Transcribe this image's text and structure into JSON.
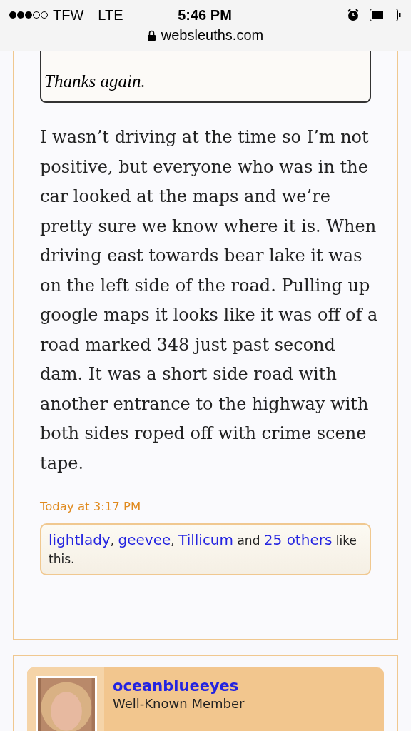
{
  "status_bar": {
    "carrier": "TFW",
    "network": "LTE",
    "time": "5:46 PM"
  },
  "address_bar": {
    "url": "websleuths.com"
  },
  "quote": {
    "text": "Thanks again."
  },
  "post": {
    "body": "I wasn’t driving at the time so I’m not positive, but everyone who was in the car looked at the maps and we’re pretty sure we know where it is. When driving east towards bear lake it was on the left side of the road. Pulling up google maps it looks like it was off of a road marked 348 just past second dam. It was a short side road with another entrance to the highway with both sides roped off with crime scene tape.",
    "date": "Today at 3:17 PM",
    "likes": [
      {
        "kind": "link",
        "text": "lightlady"
      },
      {
        "kind": "text",
        "text": ", "
      },
      {
        "kind": "link",
        "text": "geevee"
      },
      {
        "kind": "text",
        "text": ", "
      },
      {
        "kind": "link",
        "text": "Tillicum"
      },
      {
        "kind": "text",
        "text": " and "
      },
      {
        "kind": "link",
        "text": "25 others"
      },
      {
        "kind": "text",
        "text": " like this."
      }
    ]
  },
  "next_post": {
    "username": "oceanblueeyes",
    "role": "Well-Known Member"
  }
}
